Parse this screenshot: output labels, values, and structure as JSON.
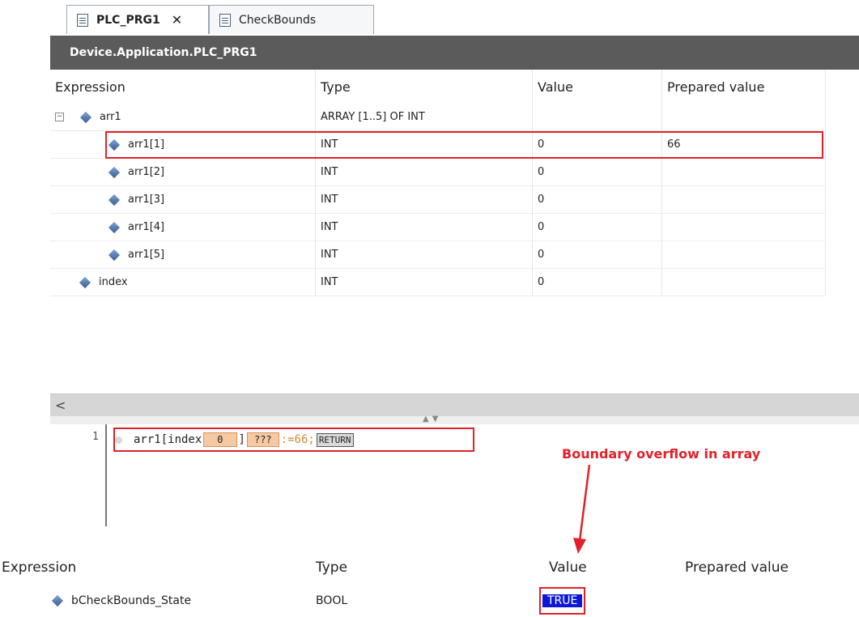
{
  "tabs": [
    {
      "label": "PLC_PRG1",
      "active": true,
      "closable": true,
      "icon": "document-icon"
    },
    {
      "label": "CheckBounds",
      "active": false,
      "closable": false,
      "icon": "document-icon"
    }
  ],
  "titlebar": "Device.Application.PLC_PRG1",
  "watch": {
    "columns": [
      "Expression",
      "Type",
      "Value",
      "Prepared value"
    ],
    "rows": [
      {
        "expression": "arr1",
        "type": "ARRAY [1..5] OF INT",
        "value": "",
        "prepared": "",
        "expandable": true
      },
      {
        "expression": "arr1[1]",
        "type": "INT",
        "value": "0",
        "prepared": "66"
      },
      {
        "expression": "arr1[2]",
        "type": "INT",
        "value": "0",
        "prepared": ""
      },
      {
        "expression": "arr1[3]",
        "type": "INT",
        "value": "0",
        "prepared": ""
      },
      {
        "expression": "arr1[4]",
        "type": "INT",
        "value": "0",
        "prepared": ""
      },
      {
        "expression": "arr1[5]",
        "type": "INT",
        "value": "0",
        "prepared": ""
      },
      {
        "expression": "index",
        "type": "INT",
        "value": "0",
        "prepared": ""
      }
    ],
    "expander_symbol": "−",
    "scroll_left": "<",
    "splitter_arrows": "▲▼"
  },
  "editor": {
    "line_number": "1",
    "code_prefix": "arr1[index",
    "inline_index": "0",
    "bracket": "]",
    "inline_element": "???",
    "assign": ":=66;",
    "return_label": "RETURN"
  },
  "annotation": "Boundary overflow in array",
  "bottom_watch": {
    "columns": [
      "Expression",
      "Type",
      "Value",
      "Prepared value"
    ],
    "row": {
      "expression": "bCheckBounds_State",
      "type": "BOOL",
      "value": "TRUE",
      "prepared": ""
    }
  },
  "colors": {
    "highlight": "#e0212a",
    "true_badge": "#0c17d8",
    "titlebar": "#5b5b5b"
  }
}
